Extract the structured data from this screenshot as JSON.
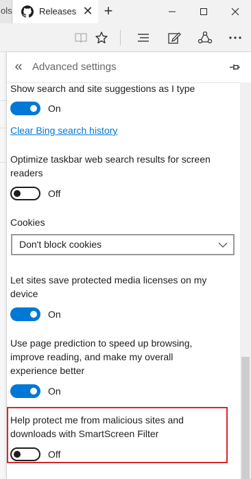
{
  "browser": {
    "partial_tab_label": "ols",
    "active_tab_title": "Releases",
    "tab_close_glyph": "✕",
    "new_tab_glyph": "+",
    "window_controls": [
      "minimize",
      "maximize",
      "close"
    ]
  },
  "toolbar": {
    "buttons": [
      "reading-view-icon",
      "favorites-star-icon",
      "hub-icon",
      "web-note-icon",
      "share-icon",
      "more-icon"
    ]
  },
  "pane": {
    "back_glyph": "«",
    "title": "Advanced settings"
  },
  "settings": {
    "suggestions": {
      "label": "Show search and site suggestions as I type",
      "state": "On"
    },
    "clear_history_link": "Clear Bing search history",
    "taskbar": {
      "label_line1": "Optimize taskbar web search results for screen",
      "label_line2": "readers",
      "state": "Off"
    },
    "cookies": {
      "label": "Cookies",
      "value": "Don't block cookies"
    },
    "media_licenses": {
      "label_line1": "Let sites save protected media licenses on my",
      "label_line2": "device",
      "state": "On"
    },
    "page_prediction": {
      "label_line1": "Use page prediction to speed up browsing,",
      "label_line2": "improve reading, and make my overall",
      "label_line3": "experience better",
      "state": "On"
    },
    "smartscreen": {
      "label_line1": "Help protect me from malicious sites and",
      "label_line2": "downloads with SmartScreen Filter",
      "state": "Off"
    }
  },
  "colors": {
    "accent": "#0078d7",
    "highlight_border": "#d9252a"
  }
}
